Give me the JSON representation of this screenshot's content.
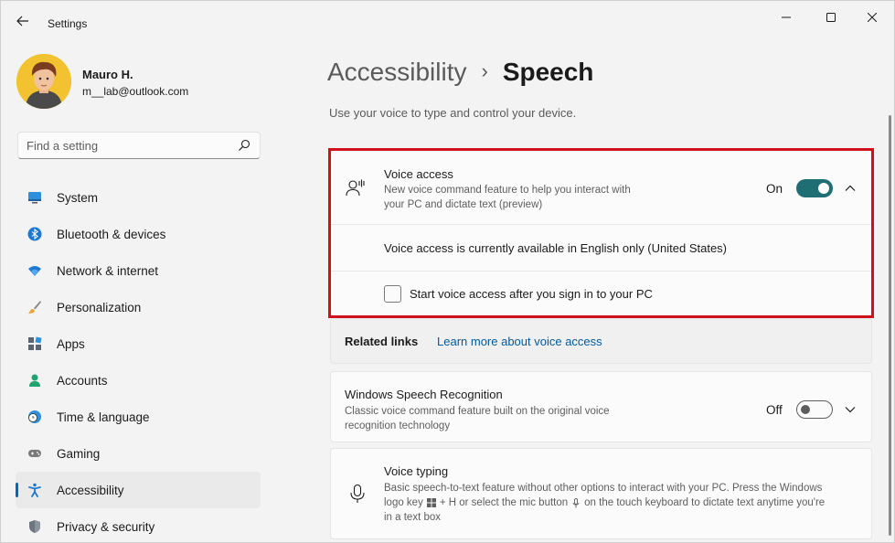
{
  "window": {
    "app_title": "Settings"
  },
  "profile": {
    "name": "Mauro H.",
    "email": "m__lab@outlook.com"
  },
  "search": {
    "placeholder": "Find a setting"
  },
  "sidebar": {
    "items": [
      {
        "label": "System",
        "icon": "system-icon",
        "active": false
      },
      {
        "label": "Bluetooth & devices",
        "icon": "bluetooth-icon",
        "active": false
      },
      {
        "label": "Network & internet",
        "icon": "wifi-icon",
        "active": false
      },
      {
        "label": "Personalization",
        "icon": "brush-icon",
        "active": false
      },
      {
        "label": "Apps",
        "icon": "apps-icon",
        "active": false
      },
      {
        "label": "Accounts",
        "icon": "person-icon",
        "active": false
      },
      {
        "label": "Time & language",
        "icon": "globe-clock-icon",
        "active": false
      },
      {
        "label": "Gaming",
        "icon": "gamepad-icon",
        "active": false
      },
      {
        "label": "Accessibility",
        "icon": "accessibility-icon",
        "active": true
      },
      {
        "label": "Privacy & security",
        "icon": "shield-icon",
        "active": false
      }
    ]
  },
  "breadcrumb": {
    "parent": "Accessibility",
    "separator": "›",
    "current": "Speech"
  },
  "page": {
    "subtitle": "Use your voice to type and control your device."
  },
  "voice_access": {
    "title": "Voice access",
    "description_line1": "New voice command feature to help you interact with",
    "description_line2": "your PC and dictate text (preview)",
    "toggle_label": "On",
    "toggle_on": true,
    "availability_text": "Voice access is currently available in English only (United States)",
    "checkbox_label": "Start voice access after you sign in to your PC",
    "checkbox_checked": false
  },
  "related_links": {
    "label": "Related links",
    "link": "Learn more about voice access"
  },
  "windows_speech_recognition": {
    "title": "Windows Speech Recognition",
    "description_line1": "Classic voice command feature built on the original voice",
    "description_line2": "recognition technology",
    "toggle_label": "Off",
    "toggle_on": false
  },
  "voice_typing": {
    "title": "Voice typing",
    "description_line1": "Basic speech-to-text feature without other options to interact with your PC. Press the Windows",
    "description_line2_a": "logo key",
    "description_line2_b": "+ H or select the mic button",
    "description_line2_c": "on the touch keyboard to dictate text anytime you're",
    "description_line3": "in a text box"
  },
  "colors": {
    "accent": "#0067c0",
    "toggle_on": "#1f6e74",
    "highlight_border": "#d1101d",
    "link": "#005a9e"
  }
}
